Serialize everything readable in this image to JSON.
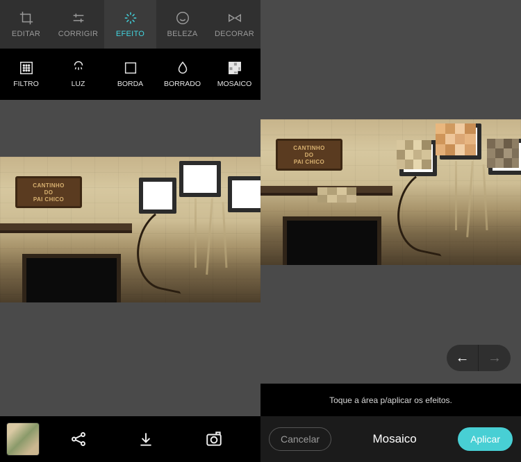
{
  "tabs": [
    {
      "id": "editar",
      "label": "EDITAR",
      "icon": "crop-icon"
    },
    {
      "id": "corrigir",
      "label": "CORRIGIR",
      "icon": "sliders-icon"
    },
    {
      "id": "efeito",
      "label": "EFEITO",
      "icon": "sparkle-icon",
      "active": true
    },
    {
      "id": "beleza",
      "label": "BELEZA",
      "icon": "smile-icon"
    },
    {
      "id": "decorar",
      "label": "DECORAR",
      "icon": "bowtie-icon"
    }
  ],
  "effect_tools": [
    {
      "id": "filtro",
      "label": "FILTRO",
      "icon": "grid-dots-icon"
    },
    {
      "id": "luz",
      "label": "LUZ",
      "icon": "lamp-icon"
    },
    {
      "id": "borda",
      "label": "BORDA",
      "icon": "border-icon"
    },
    {
      "id": "borrado",
      "label": "BORRADO",
      "icon": "droplet-icon"
    },
    {
      "id": "mosaico",
      "label": "MOSAICO",
      "icon": "mosaic-icon"
    }
  ],
  "plaque": {
    "line1": "CANTINHO",
    "line2": "DO",
    "line3": "PAI CHICO"
  },
  "right_panel": {
    "hint": "Toque a área p/aplicar os efeitos.",
    "title": "Mosaico",
    "cancel": "Cancelar",
    "apply": "Aplicar",
    "pager": {
      "prev_enabled": true,
      "next_enabled": false
    }
  },
  "bottom_actions": [
    "share-icon",
    "download-icon",
    "camera-icon"
  ]
}
